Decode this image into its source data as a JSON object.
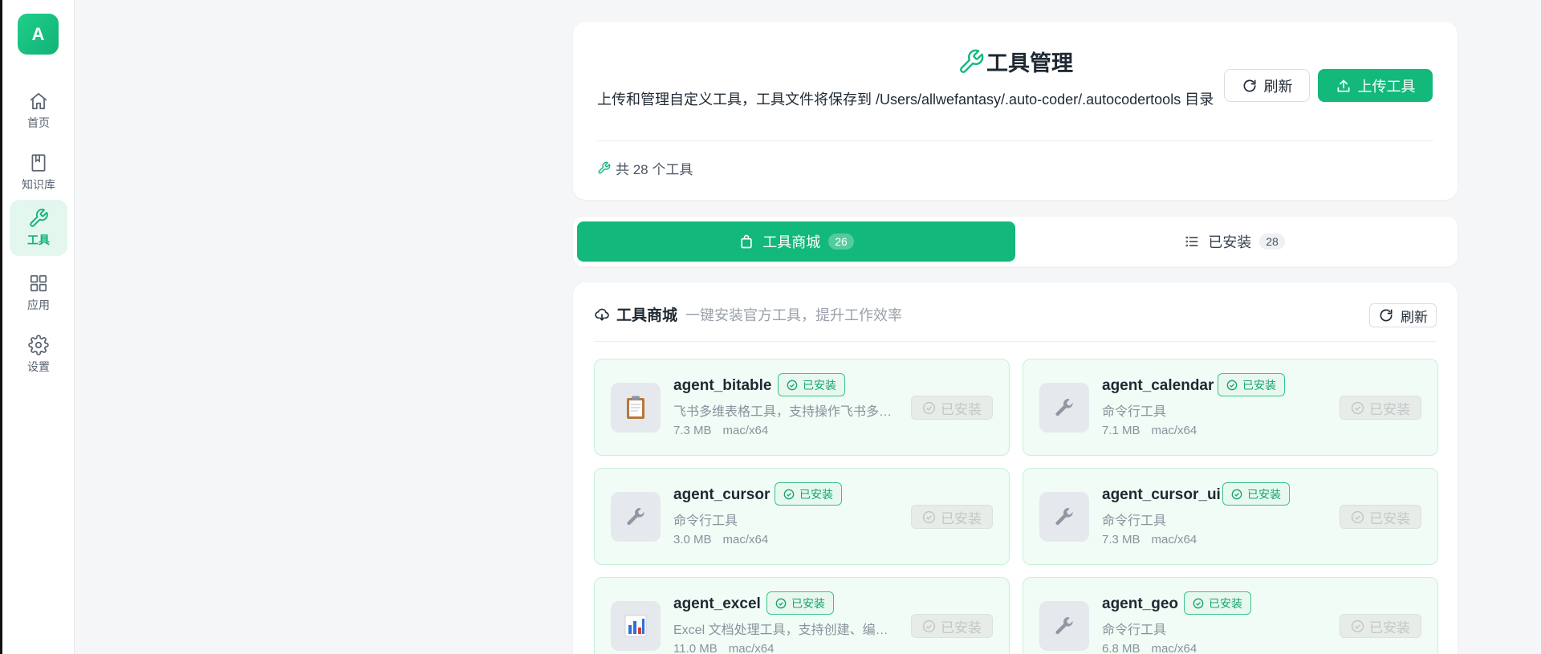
{
  "sidebar": {
    "logo": "A",
    "items": [
      {
        "label": "首页",
        "icon": "home-icon"
      },
      {
        "label": "知识库",
        "icon": "book-icon"
      },
      {
        "label": "工具",
        "icon": "wrench-icon",
        "active": true
      },
      {
        "label": "应用",
        "icon": "grid-icon"
      },
      {
        "label": "设置",
        "icon": "gear-icon"
      }
    ]
  },
  "header": {
    "title": "工具管理",
    "description": "上传和管理自定义工具，工具文件将保存到 /Users/allwefantasy/.auto-coder/.autocodertools 目录",
    "refresh_label": "刷新",
    "upload_label": "上传工具",
    "count_text": "共 28 个工具"
  },
  "tabs": [
    {
      "label": "工具商城",
      "count": "26",
      "icon": "bag-icon",
      "active": true
    },
    {
      "label": "已安装",
      "count": "28",
      "icon": "list-icon",
      "active": false
    }
  ],
  "store": {
    "title": "工具商城",
    "subtitle": "一键安装官方工具，提升工作效率",
    "refresh_label": "刷新",
    "tools": [
      {
        "name": "agent_bitable",
        "badge": "已安装",
        "description": "飞书多维表格工具，支持操作飞书多维...",
        "size": "7.3 MB",
        "platform": "mac/x64",
        "button": "已安装",
        "icon": "clipboard-icon"
      },
      {
        "name": "agent_calendar",
        "badge": "已安装",
        "description": "命令行工具",
        "size": "7.1 MB",
        "platform": "mac/x64",
        "button": "已安装",
        "icon": "wrench-icon"
      },
      {
        "name": "agent_cursor",
        "badge": "已安装",
        "description": "命令行工具",
        "size": "3.0 MB",
        "platform": "mac/x64",
        "button": "已安装",
        "icon": "wrench-icon"
      },
      {
        "name": "agent_cursor_ui",
        "badge": "已安装",
        "description": "命令行工具",
        "size": "7.3 MB",
        "platform": "mac/x64",
        "button": "已安装",
        "icon": "wrench-icon"
      },
      {
        "name": "agent_excel",
        "badge": "已安装",
        "description": "Excel 文档处理工具，支持创建、编辑...",
        "size": "11.0 MB",
        "platform": "mac/x64",
        "button": "已安装",
        "icon": "bar-chart-icon"
      },
      {
        "name": "agent_geo",
        "badge": "已安装",
        "description": "命令行工具",
        "size": "6.8 MB",
        "platform": "mac/x64",
        "button": "已安装",
        "icon": "wrench-icon"
      }
    ]
  },
  "colors": {
    "brand": "#13b87b",
    "brand_light": "#e3f7ee",
    "card_installed_bg": "#f0fcf5"
  }
}
